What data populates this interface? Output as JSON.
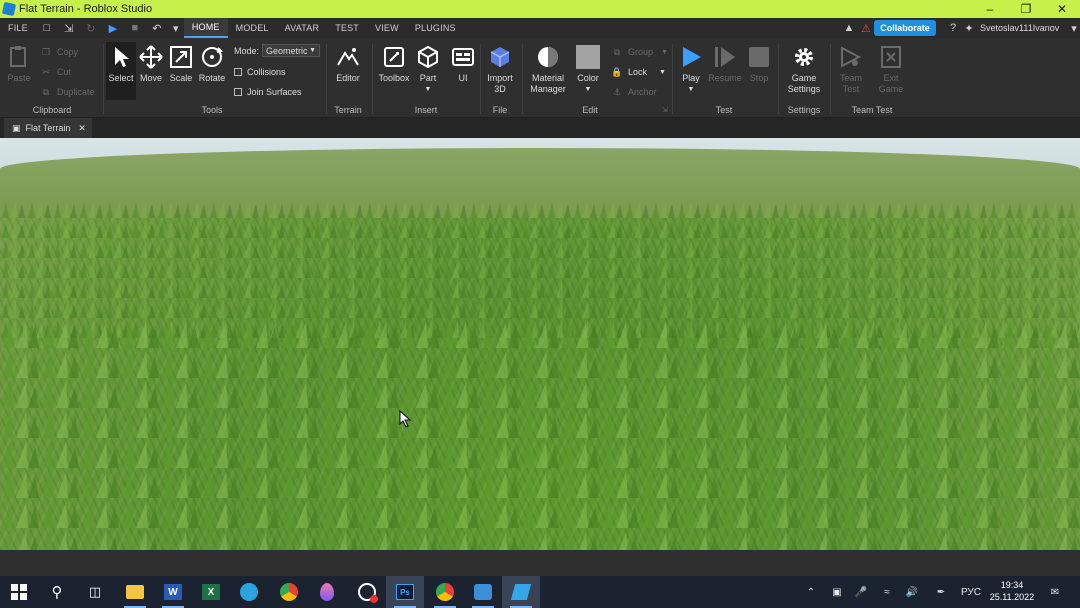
{
  "window": {
    "title": "Flat Terrain - Roblox Studio"
  },
  "menu": {
    "file": "FILE",
    "tabs": [
      "HOME",
      "MODEL",
      "AVATAR",
      "TEST",
      "VIEW",
      "PLUGINS"
    ],
    "active_tab": "HOME",
    "collaborate": "Collaborate",
    "user": "Svetoslav111Ivanov"
  },
  "ribbon": {
    "clipboard": {
      "group": "Clipboard",
      "paste": "Paste",
      "copy": "Copy",
      "cut": "Cut",
      "duplicate": "Duplicate"
    },
    "tools": {
      "group": "Tools",
      "select": "Select",
      "move": "Move",
      "scale": "Scale",
      "rotate": "Rotate",
      "mode_label": "Mode:",
      "mode_value": "Geometric",
      "collisions": "Collisions",
      "join_surfaces": "Join Surfaces"
    },
    "terrain": {
      "group": "Terrain",
      "editor": "Editor"
    },
    "insert": {
      "group": "Insert",
      "toolbox": "Toolbox",
      "part": "Part",
      "ui": "UI"
    },
    "file": {
      "group": "File",
      "import": "Import\n3D"
    },
    "edit": {
      "group": "Edit",
      "material": "Material\nManager",
      "color": "Color",
      "group_btn": "Group",
      "lock": "Lock",
      "anchor": "Anchor"
    },
    "test": {
      "group": "Test",
      "play": "Play",
      "resume": "Resume",
      "stop": "Stop"
    },
    "settings": {
      "group": "Settings",
      "game_settings": "Game\nSettings"
    },
    "team_test": {
      "group": "Team Test",
      "team_test_btn": "Team\nTest",
      "exit_game": "Exit\nGame"
    }
  },
  "document_tab": {
    "label": "Flat Terrain"
  },
  "taskbar": {
    "language": "РУС",
    "time": "19:34",
    "date": "25.11.2022"
  },
  "colors": {
    "titlebar": "#c6f04a",
    "accent": "#1f8fe0",
    "grass": "#5e9a2e",
    "taskbar": "#1b2230"
  }
}
